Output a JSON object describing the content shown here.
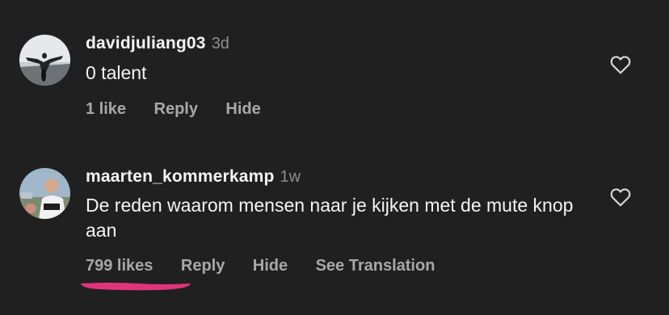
{
  "comments": [
    {
      "username": "davidjuliang03",
      "time": "3d",
      "text": "0 talent",
      "likes": "1 like",
      "reply": "Reply",
      "hide": "Hide"
    },
    {
      "username": "maarten_kommerkamp",
      "time": "1w",
      "text": "De reden waarom mensen naar je kijken met de mute knop aan",
      "likes": "799 likes",
      "reply": "Reply",
      "hide": "Hide",
      "translate": "See Translation"
    }
  ],
  "icons": {
    "like": "heart-outline-icon"
  },
  "colors": {
    "background": "#202020",
    "text": "#f5f5f5",
    "muted": "#8e8e8e",
    "action": "#a8a8a8",
    "underline_annotation": "#e0347a"
  }
}
